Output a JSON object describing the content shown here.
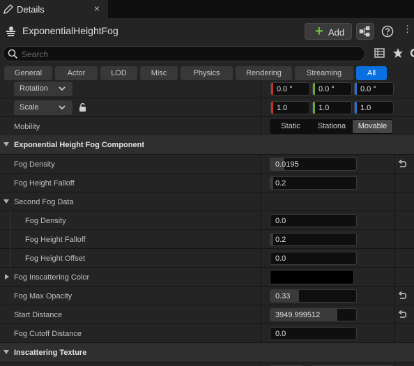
{
  "tab": {
    "title": "Details",
    "close": "×"
  },
  "header": {
    "actor_name": "ExponentialHeightFog",
    "add_label": "Add",
    "add_plus": "+",
    "more": "⋮"
  },
  "search": {
    "placeholder": "Search"
  },
  "filters": [
    "General",
    "Actor",
    "LOD",
    "Misc",
    "Physics",
    "Rendering",
    "Streaming",
    "All"
  ],
  "active_filter": "All",
  "transform": {
    "rotation": {
      "label": "Rotation",
      "x": "0.0 °",
      "y": "0.0 °",
      "z": "0.0 °"
    },
    "scale": {
      "label": "Scale",
      "x": "1.0",
      "y": "1.0",
      "z": "1.0"
    }
  },
  "mobility": {
    "label": "Mobility",
    "options": [
      "Static",
      "Stationa",
      "Movable"
    ],
    "selected": "Movable"
  },
  "component": {
    "title": "Exponential Height Fog Component",
    "fog_density": {
      "label": "Fog Density",
      "value": "0.0195",
      "fill": 0.16
    },
    "fog_height_falloff": {
      "label": "Fog Height Falloff",
      "value": "0.2"
    }
  },
  "second_fog": {
    "title": "Second Fog Data",
    "fog_density": {
      "label": "Fog Density",
      "value": "0.0"
    },
    "fog_height_falloff": {
      "label": "Fog Height Falloff",
      "value": "0.2"
    },
    "fog_height_offset": {
      "label": "Fog Height Offset",
      "value": "0.0"
    }
  },
  "fog_inscattering_color": {
    "label": "Fog Inscattering Color",
    "color": "#000000"
  },
  "fog_max_opacity": {
    "label": "Fog Max Opacity",
    "value": "0.33",
    "fill": 0.33
  },
  "start_distance": {
    "label": "Start Distance",
    "value": "3949.999512",
    "fill": 0.78
  },
  "fog_cutoff_distance": {
    "label": "Fog Cutoff Distance",
    "value": "0.0"
  },
  "inscattering_texture": {
    "title": "Inscattering Texture"
  },
  "colors": {
    "accent": "#0a70e0",
    "axis_x": "#c8302c",
    "axis_y": "#6aa634",
    "axis_z": "#2a6ed6",
    "add_green": "#6ec13a"
  }
}
